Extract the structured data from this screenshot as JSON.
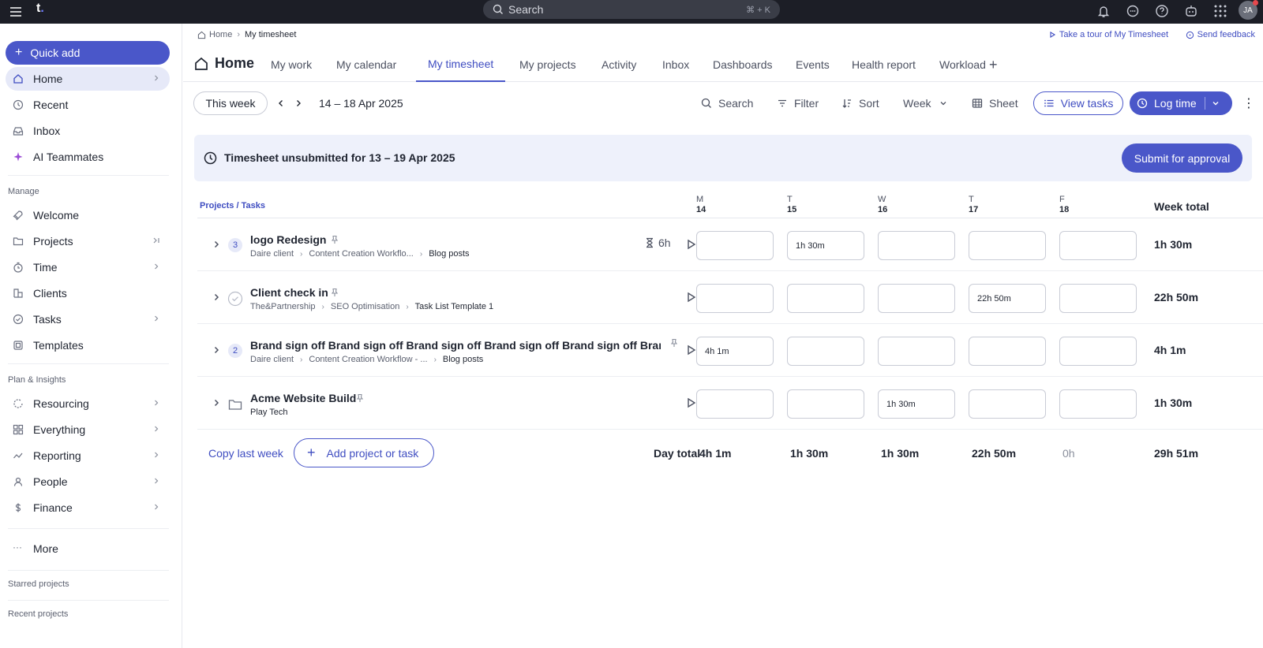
{
  "topbar": {
    "logo": "t",
    "search_placeholder": "Search",
    "search_shortcut": "⌘ + K",
    "avatar_initials": "JA"
  },
  "sidebar": {
    "quick_add": "Quick add",
    "top_items": [
      {
        "label": "Home",
        "icon": "home-icon",
        "active": true
      },
      {
        "label": "Recent",
        "icon": "clock-icon"
      },
      {
        "label": "Inbox",
        "icon": "inbox-icon"
      },
      {
        "label": "AI Teammates",
        "icon": "sparkle-icon"
      }
    ],
    "manage_title": "Manage",
    "manage_items": [
      {
        "label": "Welcome",
        "icon": "rocket-icon"
      },
      {
        "label": "Projects",
        "icon": "folder-icon"
      },
      {
        "label": "Time",
        "icon": "timer-icon"
      },
      {
        "label": "Clients",
        "icon": "clients-icon"
      },
      {
        "label": "Tasks",
        "icon": "check-circle-icon"
      },
      {
        "label": "Templates",
        "icon": "template-icon"
      }
    ],
    "plan_title": "Plan & Insights",
    "plan_items": [
      {
        "label": "Resourcing",
        "icon": "resourcing-icon"
      },
      {
        "label": "Everything",
        "icon": "grid-icon"
      },
      {
        "label": "Reporting",
        "icon": "reporting-icon"
      },
      {
        "label": "People",
        "icon": "people-icon"
      },
      {
        "label": "Finance",
        "icon": "dollar-icon"
      }
    ],
    "more": "More",
    "starred_title": "Starred projects",
    "recent_title": "Recent projects"
  },
  "breadcrumb": {
    "home": "Home",
    "current": "My timesheet"
  },
  "links": {
    "tour": "Take a tour of My Timesheet",
    "feedback": "Send feedback"
  },
  "tabs": {
    "home": "Home",
    "items": [
      "My work",
      "My calendar",
      "My timesheet",
      "My projects",
      "Activity",
      "Inbox",
      "Dashboards",
      "Events",
      "Health report",
      "Workload"
    ],
    "active": "My timesheet"
  },
  "toolbar": {
    "this_week": "This week",
    "date_range": "14 – 18 Apr 2025",
    "search": "Search",
    "filter": "Filter",
    "sort": "Sort",
    "period": "Week",
    "sheet": "Sheet",
    "view_tasks": "View tasks",
    "log_time": "Log time"
  },
  "banner": {
    "text": "Timesheet unsubmitted for 13 – 19 Apr 2025",
    "submit": "Submit for approval"
  },
  "grid": {
    "header_label": "Projects / Tasks",
    "days": [
      {
        "letter": "M",
        "num": "14"
      },
      {
        "letter": "T",
        "num": "15"
      },
      {
        "letter": "W",
        "num": "16"
      },
      {
        "letter": "T",
        "num": "17"
      },
      {
        "letter": "F",
        "num": "18"
      }
    ],
    "week_total_label": "Week total",
    "rows": [
      {
        "count": "3",
        "title": "logo Redesign",
        "crumbs": [
          "Daire client",
          "Content Creation Workflo..."
        ],
        "last": "Blog posts",
        "estimate": "6h",
        "cells": [
          "",
          "1h 30m",
          "",
          "",
          ""
        ],
        "total": "1h 30m"
      },
      {
        "count": "",
        "title": "Client check in",
        "crumbs": [
          "The&Partnership",
          "SEO Optimisation"
        ],
        "last": "Task List Template 1",
        "estimate": "",
        "cells": [
          "",
          "",
          "",
          "22h 50m",
          ""
        ],
        "total": "22h 50m"
      },
      {
        "count": "2",
        "title": "Brand sign off Brand sign off Brand sign off Brand sign off Brand sign off Brand s...",
        "crumbs": [
          "Daire client",
          "Content Creation Workflow - ..."
        ],
        "last": "Blog posts",
        "estimate": "",
        "cells": [
          "4h 1m",
          "",
          "",
          "",
          ""
        ],
        "total": "4h 1m"
      },
      {
        "count": "",
        "title": "Acme Website Build",
        "crumbs": [],
        "last": "Play Tech",
        "estimate": "",
        "cells": [
          "",
          "",
          "1h 30m",
          "",
          ""
        ],
        "total": "1h 30m"
      }
    ],
    "footer": {
      "copy_last_week": "Copy last week",
      "add": "Add project or task",
      "day_total_label": "Day total",
      "day_totals": [
        "4h 1m",
        "1h 30m",
        "1h 30m",
        "22h 50m",
        "0h"
      ],
      "week_total": "29h 51m"
    }
  }
}
